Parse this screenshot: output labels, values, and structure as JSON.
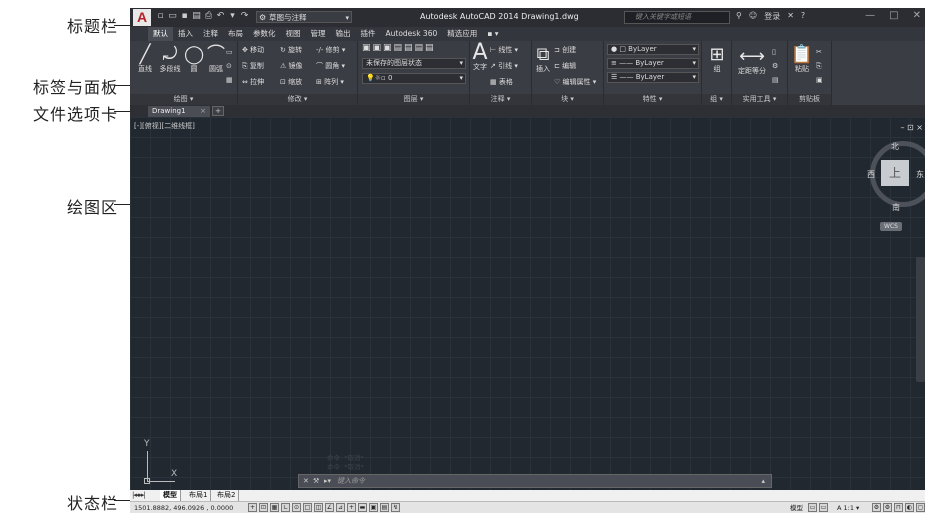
{
  "annotations": {
    "titlebar": "标题栏",
    "ribbon": "标签与面板",
    "filetabs": "文件选项卡",
    "drawing_area": "绘图区",
    "statusbar": "状态栏"
  },
  "titlebar": {
    "logo": "A",
    "workspace": "草图与注释",
    "title": "Autodesk AutoCAD 2014    Drawing1.dwg",
    "search_placeholder": "键入关键字或短语",
    "login": "登录",
    "window_controls": [
      "—",
      "□",
      "✕"
    ]
  },
  "ribbon_tabs": [
    "默认",
    "插入",
    "注释",
    "布局",
    "参数化",
    "视图",
    "管理",
    "输出",
    "插件",
    "Autodesk 360",
    "精选应用",
    "▪ ▾"
  ],
  "ribbon": {
    "draw": {
      "title": "绘图 ▾",
      "buttons": [
        "直线",
        "多段线",
        "圆",
        "圆弧"
      ]
    },
    "modify": {
      "title": "修改 ▾",
      "rows": [
        [
          "✥ 移动",
          "↻ 旋转",
          "-/- 修剪 ▾"
        ],
        [
          "⎘ 复制",
          "⚠ 镜像",
          "⌒ 圆角 ▾"
        ],
        [
          "⇔ 拉伸",
          "⊡ 缩放",
          "⊞ 阵列 ▾"
        ]
      ]
    },
    "layers": {
      "title": "图层 ▾",
      "layer_state": "未保存的图层状态",
      "current_layer": "0"
    },
    "annotation": {
      "title": "注释 ▾",
      "text": "文字",
      "items": [
        "⊢ 线性 ▾",
        "↗ 引线 ▾",
        "▦ 表格"
      ]
    },
    "block": {
      "title": "块 ▾",
      "insert": "插入",
      "items": [
        "创建",
        "编辑",
        "编辑属性 ▾"
      ]
    },
    "properties": {
      "title": "特性 ▾",
      "color": "ByLayer",
      "linetype": "ByLayer",
      "lineweight": "ByLayer"
    },
    "groups": {
      "title": "组 ▾",
      "label": "组"
    },
    "utilities": {
      "title": "实用工具 ▾",
      "label": "定距等分"
    },
    "clipboard": {
      "title": "剪贴板",
      "label": "粘贴"
    }
  },
  "file_tab": {
    "name": "Drawing1",
    "close": "×"
  },
  "drawing": {
    "view_controls": "[-][俯视][二维线框]",
    "viewport_controls": "– ⊡ ×",
    "compass": {
      "north": "北",
      "south": "南",
      "west": "西",
      "east": "东",
      "face": "上"
    },
    "wcs": "WCS",
    "ucs_y": "Y",
    "ucs_x": "X",
    "command_history": [
      "命令: *取消*",
      "命令: *取消*"
    ]
  },
  "command_line": {
    "placeholder": "键入命令"
  },
  "layout_tabs": [
    "模型",
    "布局1",
    "布局2"
  ],
  "statusbar": {
    "coords": "1501.8882, 496.0926 , 0.0000",
    "right_items": [
      "模型",
      "A 1:1 ▾"
    ]
  }
}
